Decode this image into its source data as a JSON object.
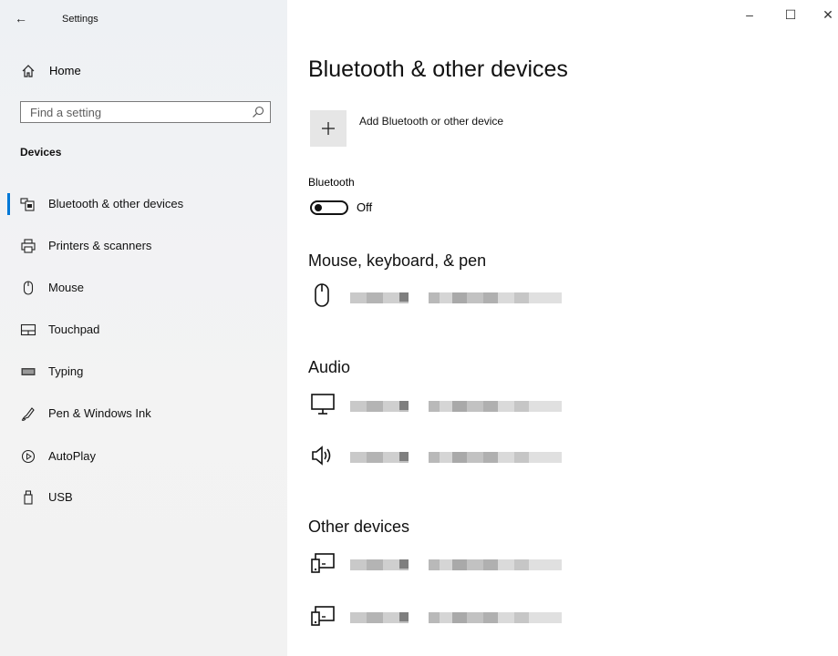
{
  "window": {
    "title": "Settings",
    "back_glyph": "←",
    "minimize_glyph": "–",
    "maximize_glyph": "☐",
    "close_glyph": "✕"
  },
  "sidebar": {
    "home_label": "Home",
    "search_placeholder": "Find a setting",
    "section": "Devices",
    "items": [
      {
        "label": "Bluetooth & other devices",
        "icon": "bluetooth-devices-icon",
        "selected": true
      },
      {
        "label": "Printers & scanners",
        "icon": "printer-icon"
      },
      {
        "label": "Mouse",
        "icon": "mouse-icon"
      },
      {
        "label": "Touchpad",
        "icon": "touchpad-icon"
      },
      {
        "label": "Typing",
        "icon": "keyboard-icon"
      },
      {
        "label": "Pen & Windows Ink",
        "icon": "pen-icon"
      },
      {
        "label": "AutoPlay",
        "icon": "autoplay-icon"
      },
      {
        "label": "USB",
        "icon": "usb-icon"
      }
    ]
  },
  "main": {
    "title": "Bluetooth & other devices",
    "add_device_label": "Add Bluetooth or other device",
    "bluetooth_label": "Bluetooth",
    "bluetooth_state": "Off",
    "groups": [
      {
        "heading": "Mouse, keyboard, & pen",
        "devices": [
          {
            "icon": "mouse-icon"
          }
        ]
      },
      {
        "heading": "Audio",
        "devices": [
          {
            "icon": "monitor-icon"
          },
          {
            "icon": "speaker-icon"
          }
        ]
      },
      {
        "heading": "Other devices",
        "devices": [
          {
            "icon": "generic-device-icon"
          },
          {
            "icon": "generic-device-icon"
          }
        ]
      }
    ]
  },
  "colors": {
    "accent": "#0078d7",
    "sidebar_bg": "#f2f2f2",
    "add_button_bg": "#e6e6e6"
  }
}
